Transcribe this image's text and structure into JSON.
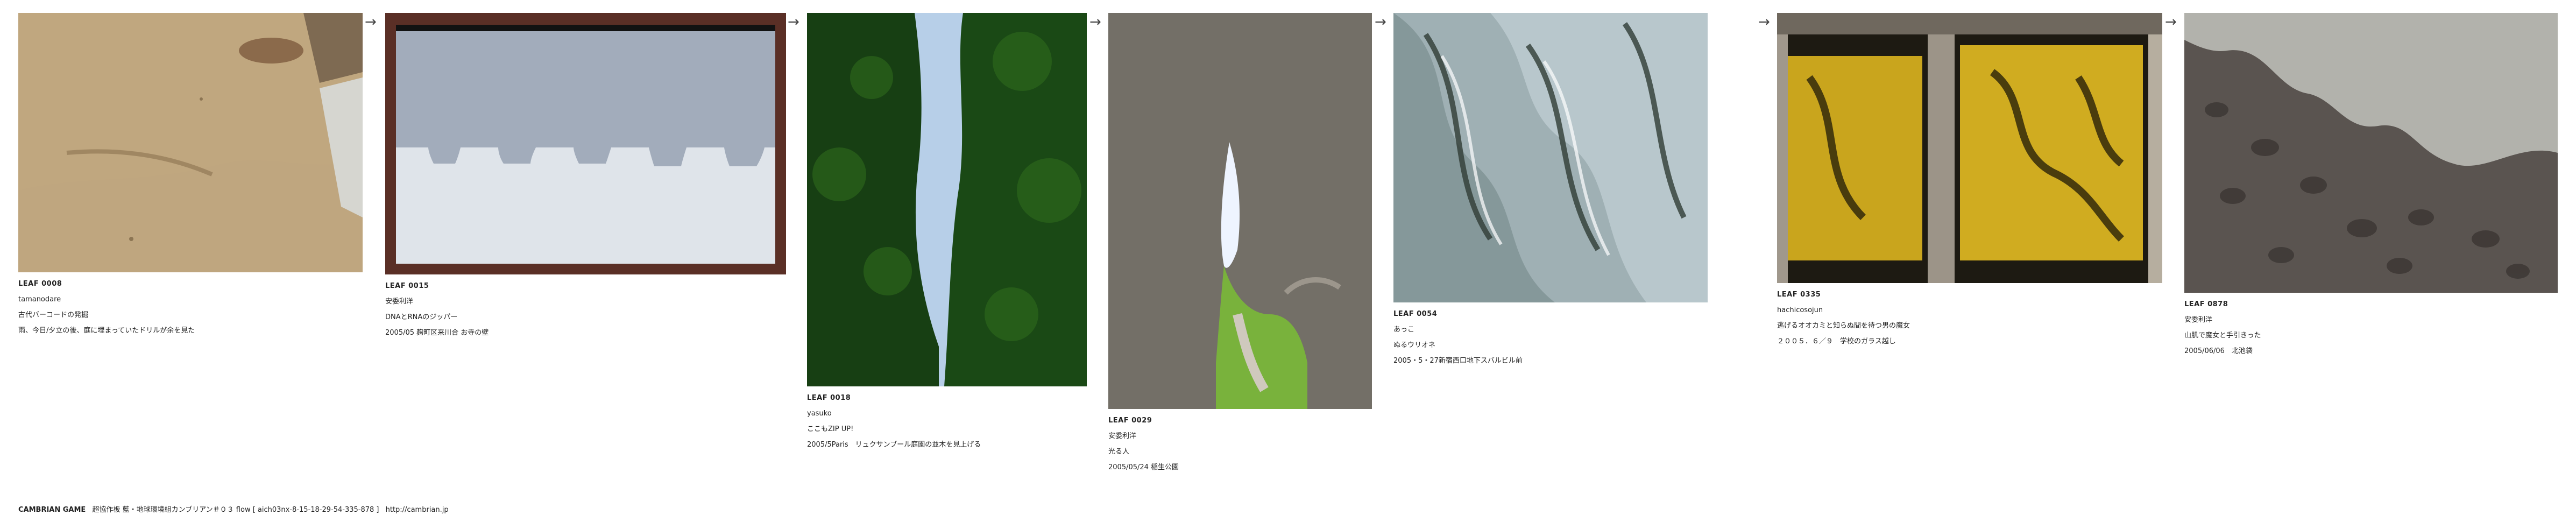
{
  "leaves": [
    {
      "id": "LEAF 0008",
      "author": "tamanodare",
      "title": "古代バーコードの発掘",
      "comment": "雨、今日/夕立の後、庭に埋まっていたドリルが余を見た",
      "colors": {
        "base": "#c7b08a",
        "shade": "#8c7553"
      }
    },
    {
      "id": "LEAF 0015",
      "author": "安委利洋",
      "title": "DNAとRNAのジッパー",
      "comment": "2005/05 麹町区来川合 お寺の壁",
      "colors": {
        "frame": "#5a2f26",
        "top": "#151515",
        "wall": "#dfe4ea"
      }
    },
    {
      "id": "LEAF 0018",
      "author": "yasuko",
      "title": "ここもZIP UP!",
      "comment": "2005/5Paris　リュクサンブール庭園の並木を見上げる",
      "colors": {
        "leaf": "#173f13",
        "sky": "#b7cfe8"
      }
    },
    {
      "id": "LEAF 0029",
      "author": "安委利洋",
      "title": "光る人",
      "comment": "2005/05/24 稲生公園",
      "colors": {
        "bark": "#6d6a63",
        "light": "#eef4ff",
        "green": "#79b23c"
      }
    },
    {
      "id": "LEAF 0054",
      "author": "あっこ",
      "title": "ぬるウリオネ",
      "comment": "2005・5・27新宿西口地下スバルビル前",
      "colors": {
        "glass": "#a9b9be",
        "dark": "#39473e"
      }
    },
    {
      "id": "LEAF 0335",
      "author": "hachicosojun",
      "title": "逃げるオオカミと知らぬ間を待つ男の魔女",
      "comment": "２００５．６／９　学校のガラス越し",
      "colors": {
        "frame": "#a0988c",
        "glass": "#c9a51d",
        "dark": "#33290a"
      }
    },
    {
      "id": "LEAF 0878",
      "author": "安委利洋",
      "title": "山肌で魔女と手引きった",
      "comment": "2005/06/06　北池袋",
      "colors": {
        "plaster": "#b2b2ac",
        "stone": "#5a5450"
      }
    }
  ],
  "arrow_glyph": "→",
  "footer": {
    "brand": "CAMBRIAN GAME",
    "credits": "超協作板 藍・地球環境組カンブリアン＃０３ flow [ aich03nx-8-15-18-29-54-335-878 ]",
    "url": "http://cambrian.jp"
  }
}
